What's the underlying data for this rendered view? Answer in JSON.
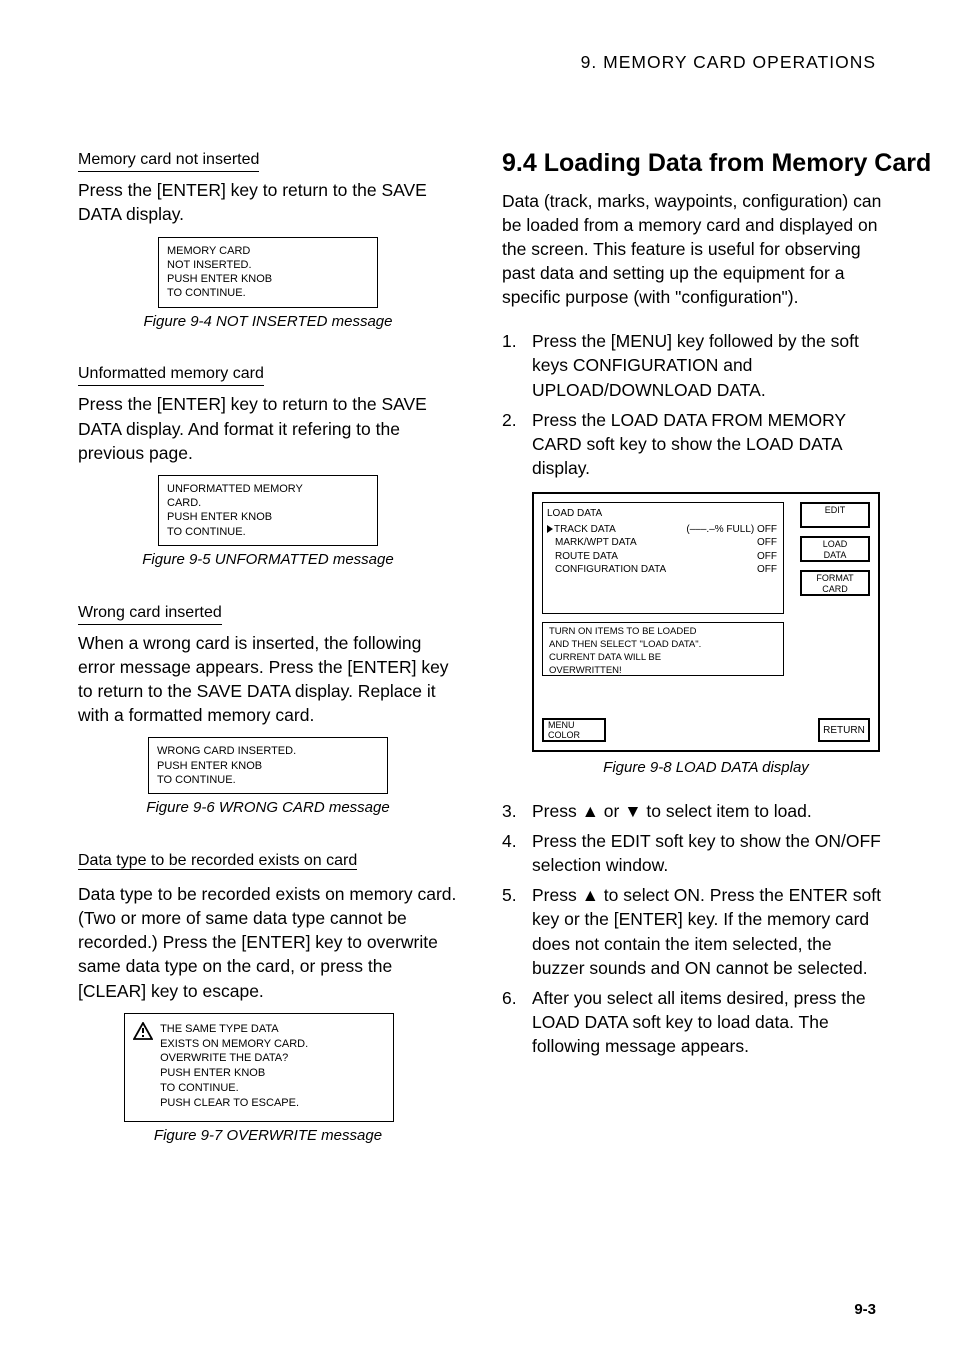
{
  "header": "9.  MEMORY  CARD  OPERATIONS",
  "left": {
    "sub1": "Memory card not inserted",
    "para1": "Press the [ENTER] key to return to the SAVE DATA display.",
    "box1_l1": "MEMORY CARD",
    "box1_l2": "NOT INSERTED.",
    "box1_l3": "PUSH ENTER KNOB",
    "box1_l4": "TO CONTINUE.",
    "fig1": "Figure 9-4 NOT INSERTED message",
    "sub2": "Unformatted memory card",
    "para2": "Press the [ENTER] key to return to the SAVE DATA display. And format it refering to the previous page.",
    "box2_l1": "UNFORMATTED MEMORY",
    "box2_l2": "CARD.",
    "box2_l3": "PUSH ENTER KNOB",
    "box2_l4": "TO CONTINUE.",
    "fig2": "Figure 9-5 UNFORMATTED message",
    "sub3": "Wrong card inserted",
    "para3": "When a wrong card is inserted, the following error message appears. Press the [ENTER] key to return to the SAVE DATA display. Replace it with a formatted memory card.",
    "box3_l1": "WRONG CARD INSERTED.",
    "box3_l2": "PUSH ENTER KNOB",
    "box3_l3": "TO CONTINUE.",
    "fig3": "Figure 9-6 WRONG CARD message",
    "sub4": "Data type to be recorded exists on card",
    "para4": "Data type to be recorded exists on memory card. (Two or more of same data type cannot be recorded.) Press the [ENTER] key to overwrite same data type on the card, or press the [CLEAR] key to escape.",
    "warn_l1": "THE SAME TYPE DATA",
    "warn_l2": "EXISTS ON MEMORY CARD.",
    "warn_l3": "OVERWRITE THE DATA?",
    "warn_l4": "PUSH ENTER KNOB",
    "warn_l5": "TO CONTINUE.",
    "warn_l6": "PUSH CLEAR TO ESCAPE.",
    "fig4": "Figure 9-7 OVERWRITE message"
  },
  "right": {
    "heading": "9.4 Loading Data from Memory Card",
    "intro": "Data (track, marks, waypoints, configuration) can be loaded from a memory card and displayed on the screen. This feature is useful for observing past data and setting up the equipment for a specific purpose (with \"configuration\").",
    "step1": "Press the [MENU] key followed by the soft keys CONFIGURATION and UPLOAD/DOWNLOAD DATA.",
    "step2": "Press the LOAD DATA FROM MEMORY CARD soft key to show the LOAD DATA display.",
    "load": {
      "title": "LOAD DATA",
      "r1a": "TRACK DATA",
      "r1b": "(–––.–% FULL) OFF",
      "r2a": "MARK/WPT DATA",
      "r2b": "OFF",
      "r3a": "ROUTE DATA",
      "r3b": "OFF",
      "r4a": "CONFIGURATION DATA",
      "r4b": "OFF",
      "instr_l1": "TURN ON ITEMS TO BE LOADED",
      "instr_l2": "AND THEN SELECT \"LOAD DATA\".",
      "instr_l3": "   CURRENT DATA WILL BE",
      "instr_l4": "   OVERWRITTEN!",
      "sk1": "EDIT",
      "sk2_l1": "LOAD",
      "sk2_l2": "DATA",
      "sk3_l1": "FORMAT",
      "sk3_l2": "CARD",
      "menu_l1": "MENU",
      "menu_l2": "COLOR",
      "return": "RETURN"
    },
    "fig5": "Figure 9-8 LOAD DATA display",
    "step3": "Press ▲ or ▼ to select item to load.",
    "step4": "Press the EDIT soft key to show the ON/OFF selection window.",
    "step5": "Press ▲ to select ON. Press the ENTER soft key or the [ENTER] key. If the memory card does not contain the item selected, the buzzer sounds and ON cannot be selected.",
    "step6": "After you select all items desired, press the LOAD DATA soft key to load data. The following message appears."
  },
  "page_num": "9-3"
}
